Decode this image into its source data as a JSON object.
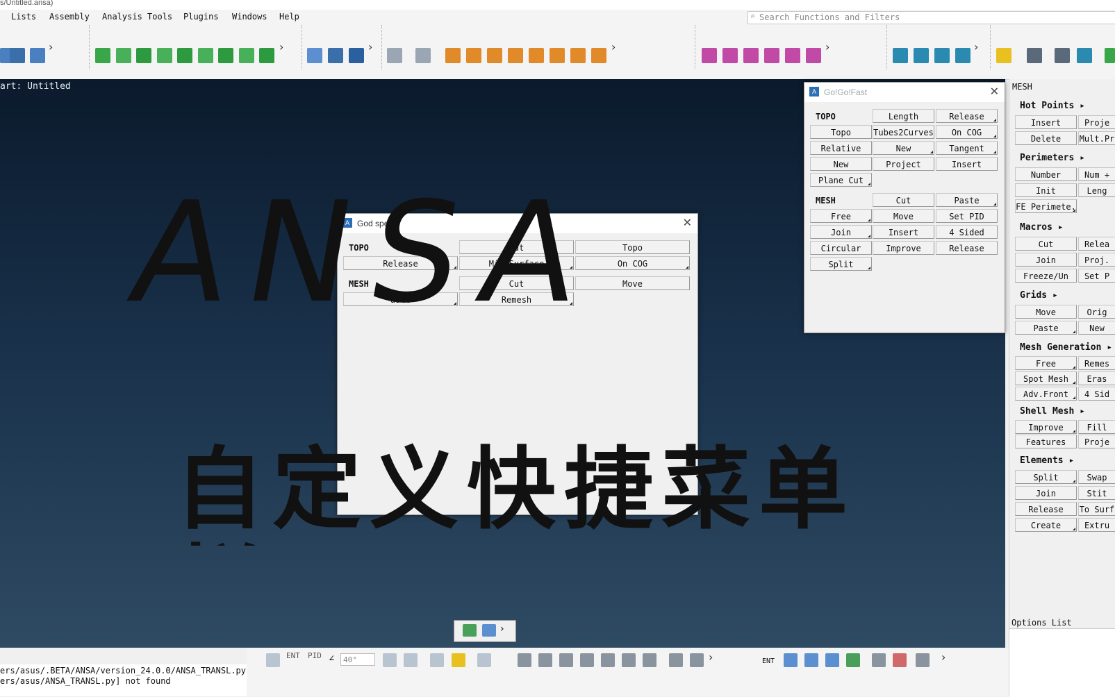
{
  "window": {
    "title": "s/Untitled.ansa)"
  },
  "menu": [
    "Lists",
    "Assembly",
    "Analysis Tools",
    "Plugins",
    "Windows",
    "Help"
  ],
  "search": {
    "placeholder": "Search Functions and Filters"
  },
  "viewport": {
    "part_label": "art: Untitled"
  },
  "godspeed": {
    "title": "God speed!",
    "topo_label": "TOPO",
    "mesh_label": "MESH",
    "topo_buttons": [
      "Cut",
      "Topo",
      "Release",
      "Mid.Surface",
      "On COG"
    ],
    "mesh_buttons": [
      "Cut",
      "Move",
      "aste",
      "Remesh"
    ]
  },
  "gogofast": {
    "title": "Go!Go!Fast",
    "topo_label": "TOPO",
    "mesh_label": "MESH",
    "topo_buttons": [
      "Length",
      "Release",
      "Topo",
      "Tubes2Curves",
      "On COG",
      "Relative",
      "New",
      "Tangent",
      "New",
      "Project",
      "Insert",
      "Plane Cut"
    ],
    "mesh_buttons": [
      "Cut",
      "Paste",
      "Free",
      "Move",
      "Set PID",
      "Join",
      "Insert",
      "4 Sided",
      "Circular",
      "Improve",
      "Release",
      "Split"
    ]
  },
  "right_panel": {
    "title": "MESH",
    "sections": [
      {
        "name": "Hot Points",
        "buttons": [
          "Insert",
          "Proje",
          "Delete",
          "Mult.Pr"
        ]
      },
      {
        "name": "Perimeters",
        "buttons": [
          "Number",
          "Num +",
          "Init",
          "Leng",
          "FE Perimete."
        ]
      },
      {
        "name": "Macros",
        "buttons": [
          "Cut",
          "Relea",
          "Join",
          "Proj.",
          "Freeze/Un",
          "Set P"
        ]
      },
      {
        "name": "Grids",
        "buttons": [
          "Move",
          "Orig",
          "Paste",
          "New"
        ]
      },
      {
        "name": "Mesh Generation",
        "buttons": [
          "Free",
          "Remes",
          "Spot Mesh",
          "Eras",
          "Adv.Front",
          "4 Sid"
        ]
      },
      {
        "name": "Shell Mesh",
        "buttons": [
          "Improve",
          "Fill",
          "Features",
          "Proje"
        ]
      },
      {
        "name": "Elements",
        "buttons": [
          "Split",
          "Swap",
          "Join",
          "Stit",
          "Release",
          "To Surf",
          "Create",
          "Extru"
        ]
      }
    ],
    "options_label": "Options List"
  },
  "console": [
    "ers/asus/.BETA/ANSA/version_24.0.0/ANSA_TRANSL.py]",
    "ers/asus/ANSA_TRANSL.py] not found"
  ],
  "bottom": {
    "ent": "ENT",
    "pid": "PID",
    "angle": "40°",
    "ent2": "ENT"
  },
  "overlay": {
    "ansa": "ANSA",
    "chinese": "自定义快捷菜单栏"
  }
}
